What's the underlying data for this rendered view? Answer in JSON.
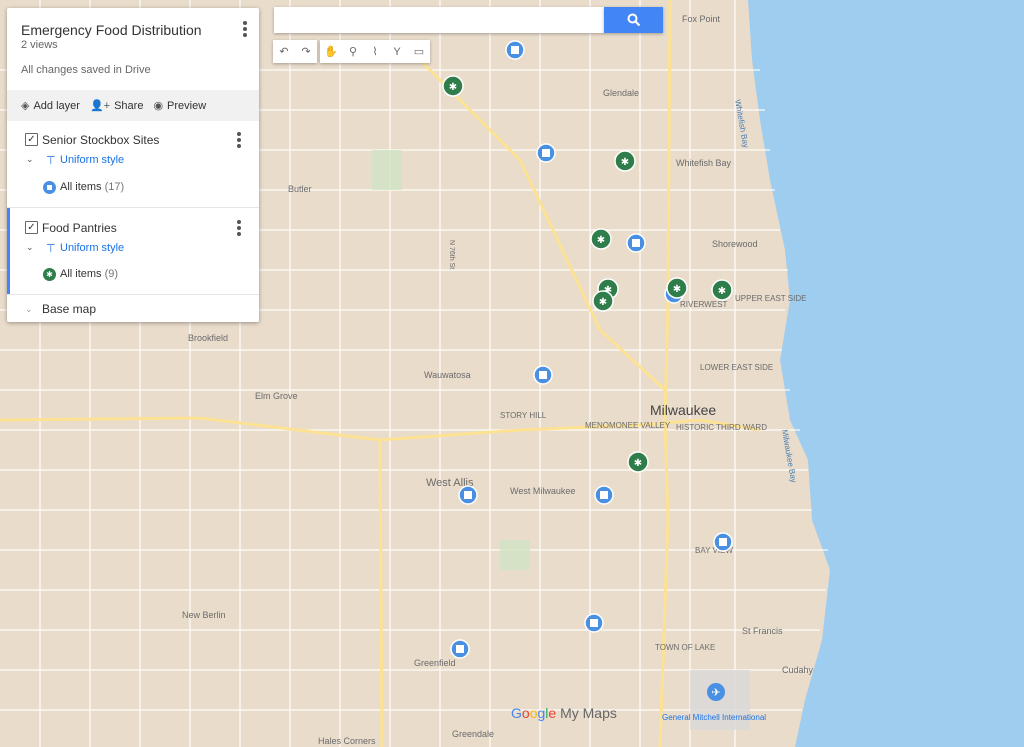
{
  "panel": {
    "title": "Emergency Food Distribution",
    "views": "2 views",
    "saved": "All changes saved in Drive",
    "toolbar": {
      "add_layer": "Add layer",
      "share": "Share",
      "preview": "Preview"
    },
    "layers": [
      {
        "name": "Senior Stockbox Sites",
        "style": "Uniform style",
        "items_label": "All items",
        "items_count": "(17)"
      },
      {
        "name": "Food Pantries",
        "style": "Uniform style",
        "items_label": "All items",
        "items_count": "(9)"
      }
    ],
    "base_map": "Base map"
  },
  "search": {
    "placeholder": ""
  },
  "map_labels": {
    "fox_point": "Fox Point",
    "glendale": "Glendale",
    "whitefish_bay": "Whitefish Bay",
    "whitefish_bay_water": "Whitefish Bay",
    "shorewood": "Shorewood",
    "butler": "Butler",
    "brookfield": "Brookfield",
    "elm_grove": "Elm Grove",
    "wauwatosa": "Wauwatosa",
    "story_hill": "STORY HILL",
    "menomonee_valley": "MENOMONEE VALLEY",
    "milwaukee": "Milwaukee",
    "historic_third_ward": "HISTORIC THIRD WARD",
    "lower_east_side": "LOWER EAST SIDE",
    "upper_east_side": "UPPER EAST SIDE",
    "riverwest": "RIVERWEST",
    "west_allis": "West Allis",
    "west_milwaukee": "West Milwaukee",
    "bay_view": "BAY VIEW",
    "new_berlin": "New Berlin",
    "greenfield": "Greenfield",
    "town_of_lake": "TOWN OF LAKE",
    "st_francis": "St Francis",
    "cudahy": "Cudahy",
    "general_mitchell": "General Mitchell International",
    "greendale": "Greendale",
    "hales_corners": "Hales Corners",
    "milwaukee_bay": "Milwaukee Bay",
    "n_76th": "N 76th St"
  },
  "brand": {
    "my_maps": "My Maps"
  },
  "colors": {
    "water": "#9fcdf0",
    "land": "#e9dccb",
    "stockbox": "#4a90e2",
    "pantry": "#2e7d4a",
    "road": "#ffffff",
    "highway": "#fde293"
  }
}
